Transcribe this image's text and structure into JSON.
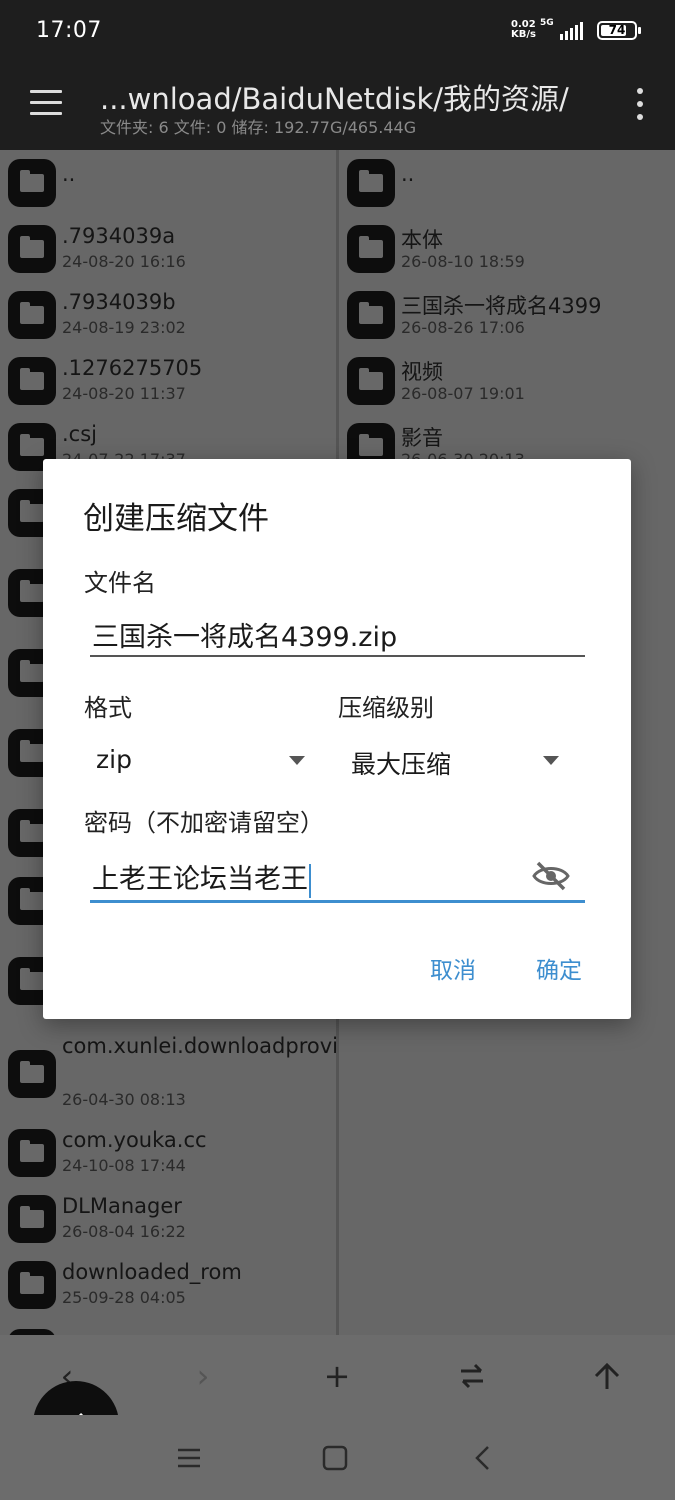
{
  "status": {
    "time": "17:07",
    "net_speed_value": "0.02",
    "net_speed_unit": "KB/s",
    "network": "5G",
    "battery": "74"
  },
  "header": {
    "path": "...wnload/BaiduNetdisk/我的资源/",
    "meta": "文件夹: 6  文件: 0  储存: 192.77G/465.44G"
  },
  "left_pane": {
    "items": [
      {
        "name": "..",
        "date": ""
      },
      {
        "name": ".7934039a",
        "date": "24-08-20 16:16"
      },
      {
        "name": ".7934039b",
        "date": "24-08-19 23:02"
      },
      {
        "name": ".1276275705",
        "date": "24-08-20 11:37"
      },
      {
        "name": ".csj",
        "date": "24-07-22 17:37"
      },
      {
        "name": "com.xunlei.downloadprovider.pan.lite",
        "date": "26-04-30 08:13"
      },
      {
        "name": "com.youka.cc",
        "date": "24-10-08 17:44"
      },
      {
        "name": "DLManager",
        "date": "26-08-04 16:22"
      },
      {
        "name": "downloaded_rom",
        "date": "25-09-28 04:05"
      }
    ]
  },
  "right_pane": {
    "items": [
      {
        "name": "..",
        "date": ""
      },
      {
        "name": "本体",
        "date": "26-08-10 18:59"
      },
      {
        "name": "三国杀一将成名4399",
        "date": "26-08-26 17:06"
      },
      {
        "name": "视频",
        "date": "26-08-07 19:01"
      },
      {
        "name": "影音",
        "date": "26-06-30 20:13"
      }
    ]
  },
  "dialog": {
    "title": "创建压缩文件",
    "filename_label": "文件名",
    "filename_value": "三国杀一将成名4399.zip",
    "format_label": "格式",
    "format_value": "zip",
    "level_label": "压缩级别",
    "level_value": "最大压缩",
    "password_label": "密码（不加密请留空）",
    "password_value": "上老王论坛当老王",
    "cancel": "取消",
    "ok": "确定"
  },
  "colors": {
    "accent": "#3d8ecf",
    "bar": "#1e1e1e",
    "scrim_list": "#676767"
  }
}
